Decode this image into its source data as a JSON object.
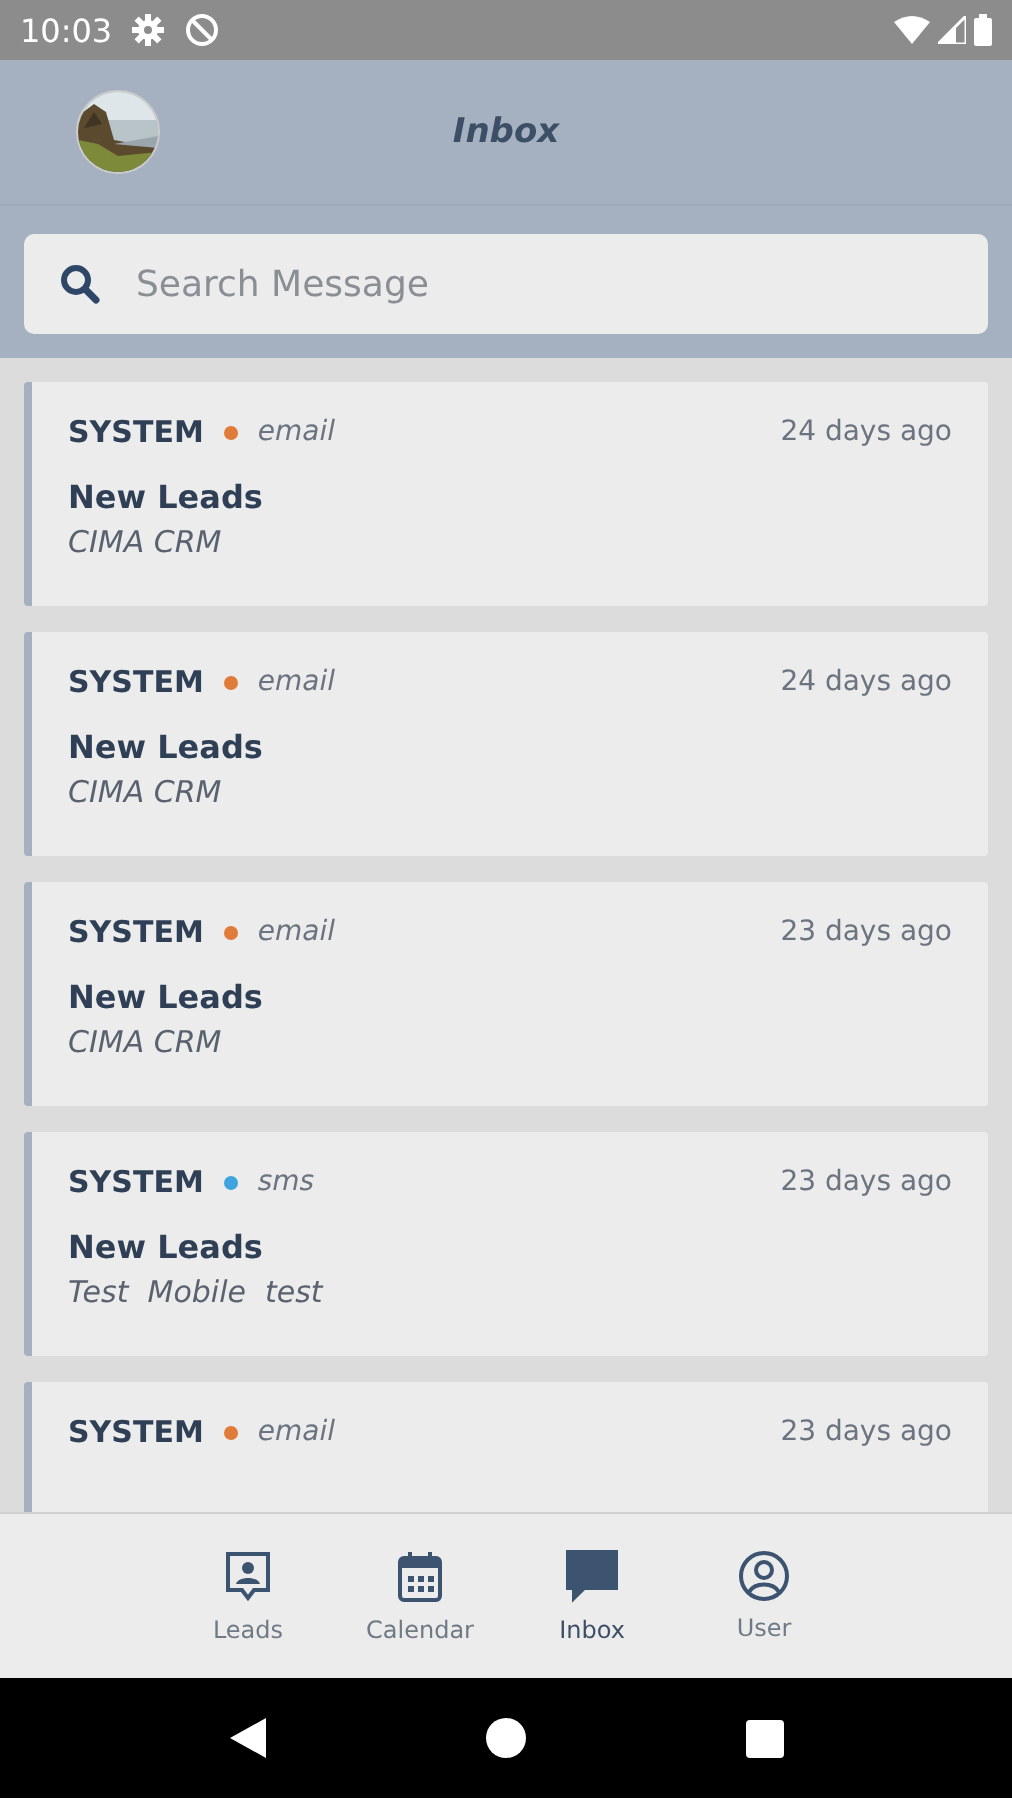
{
  "status_bar": {
    "time": "10:03"
  },
  "header": {
    "title": "Inbox"
  },
  "search": {
    "placeholder": "Search Message"
  },
  "messages": [
    {
      "sender": "SYSTEM",
      "channel": "email",
      "color": "#e07b39",
      "time": "24 days ago",
      "title": "New Leads",
      "body": "CIMA CRM"
    },
    {
      "sender": "SYSTEM",
      "channel": "email",
      "color": "#e07b39",
      "time": "24 days ago",
      "title": "New Leads",
      "body": "CIMA CRM"
    },
    {
      "sender": "SYSTEM",
      "channel": "email",
      "color": "#e07b39",
      "time": "23 days ago",
      "title": "New Leads",
      "body": "CIMA CRM"
    },
    {
      "sender": "SYSTEM",
      "channel": "sms",
      "color": "#3fa3dd",
      "time": "23 days ago",
      "title": "New Leads",
      "body": "Test  Mobile  test"
    },
    {
      "sender": "SYSTEM",
      "channel": "email",
      "color": "#e07b39",
      "time": "23 days ago"
    }
  ],
  "tabs": [
    {
      "kind": "leads",
      "label": "Leads",
      "selected": false
    },
    {
      "kind": "calendar",
      "label": "Calendar",
      "selected": false
    },
    {
      "kind": "inbox",
      "label": "Inbox",
      "selected": true
    },
    {
      "kind": "user",
      "label": "User",
      "selected": false
    }
  ]
}
